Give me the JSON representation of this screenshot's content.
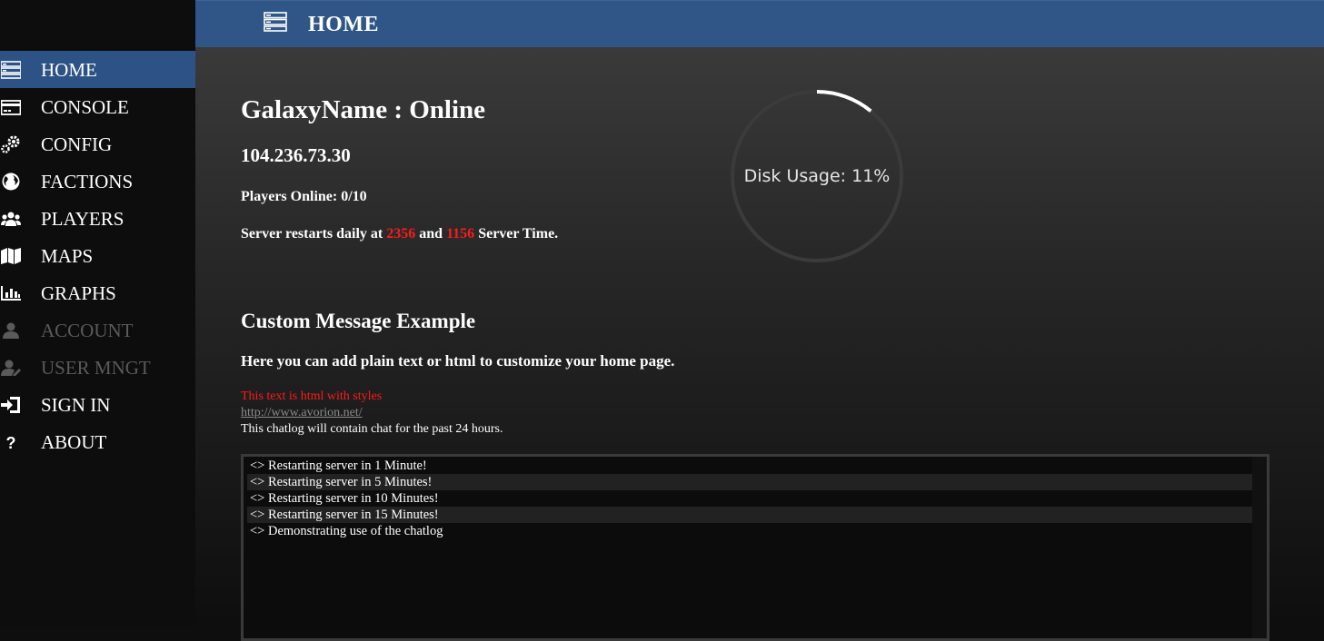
{
  "header": {
    "title": "HOME",
    "icon": "server-icon"
  },
  "sidebar": {
    "items": [
      {
        "label": "HOME",
        "icon": "server-icon",
        "active": true,
        "disabled": false
      },
      {
        "label": "CONSOLE",
        "icon": "credit-card-icon",
        "active": false,
        "disabled": false
      },
      {
        "label": "CONFIG",
        "icon": "cogs-icon",
        "active": false,
        "disabled": false
      },
      {
        "label": "FACTIONS",
        "icon": "globe-icon",
        "active": false,
        "disabled": false
      },
      {
        "label": "PLAYERS",
        "icon": "users-icon",
        "active": false,
        "disabled": false
      },
      {
        "label": "MAPS",
        "icon": "map-icon",
        "active": false,
        "disabled": false
      },
      {
        "label": "GRAPHS",
        "icon": "bar-chart-icon",
        "active": false,
        "disabled": false
      },
      {
        "label": "ACCOUNT",
        "icon": "user-icon",
        "active": false,
        "disabled": true
      },
      {
        "label": "USER MNGT",
        "icon": "user-manage-icon",
        "active": false,
        "disabled": true
      },
      {
        "label": "SIGN IN",
        "icon": "sign-in-icon",
        "active": false,
        "disabled": false
      },
      {
        "label": "ABOUT",
        "icon": "question-icon",
        "active": false,
        "disabled": false
      }
    ]
  },
  "main": {
    "galaxy_title": "GalaxyName : Online",
    "ip": "104.236.73.30",
    "players_online": "Players Online: 0/10",
    "restart": {
      "prefix": "Server restarts daily at ",
      "time1": "2356",
      "mid": " and ",
      "time2": "1156",
      "suffix": " Server Time."
    },
    "disk": {
      "label": "Disk Usage: 11%",
      "percent": 11
    },
    "custom_title": "Custom Message Example",
    "custom_desc": "Here you can add plain text or html to customize your home page.",
    "styled_text": "This text is html with styles",
    "link": "http://www.avorion.net/",
    "chat_note": "This chatlog will contain chat for the past 24 hours."
  },
  "chatlog": [
    "<> Restarting server in 1 Minute!",
    "<> Restarting server in 5 Minutes!",
    "<> Restarting server in 10 Minutes!",
    "<> Restarting server in 15 Minutes!",
    "<> Demonstrating use of the chatlog"
  ],
  "colors": {
    "accent": "#2f5686",
    "highlight_red": "#ff1a1a",
    "disabled": "#5a5a5a"
  }
}
